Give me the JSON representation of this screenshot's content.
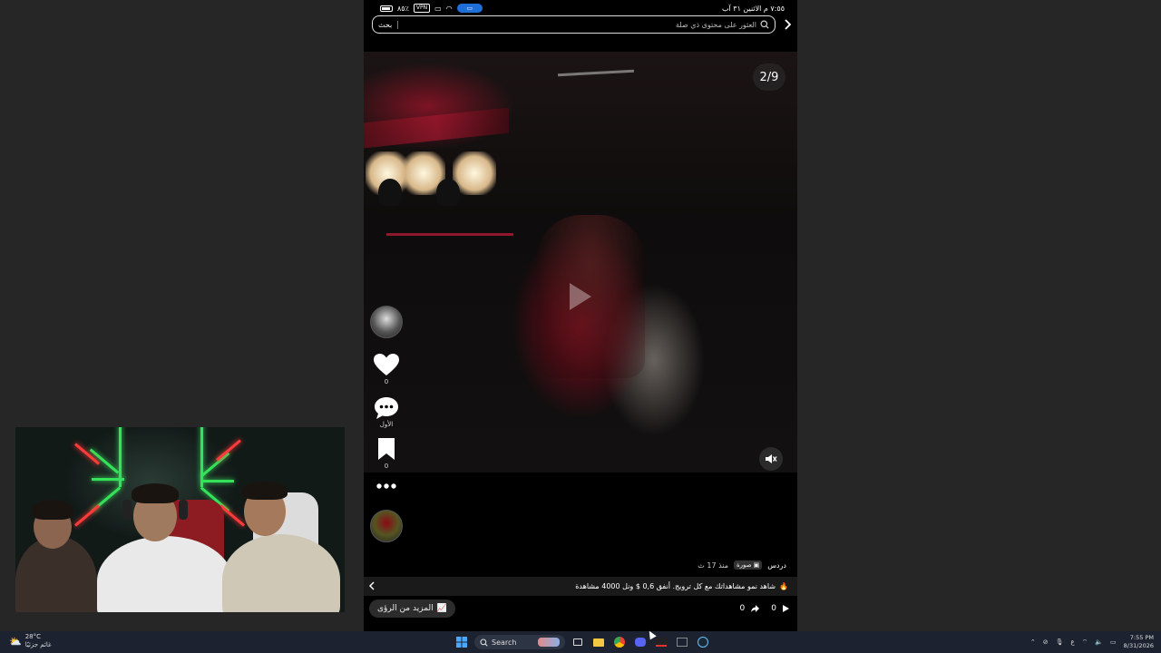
{
  "status_bar": {
    "time_date": "٧:٥٥ م  الاثنين ٣١ آب",
    "battery": "٨٥٪",
    "vpn": "VPN"
  },
  "search": {
    "placeholder": "العثور على محتوى ذي صلة",
    "button_label": "بحث"
  },
  "video": {
    "counter": "2/9"
  },
  "actions": {
    "like_count": "0",
    "comment_label": "الأول",
    "save_count": "0"
  },
  "post_meta": {
    "category": "دردس",
    "badge": "صورة",
    "time": "منذ 17 ث"
  },
  "promo": {
    "text": "شاهد نمو مشاهداتك مع كل ترويج. أنفق 0,6 $ ونل 4000 مشاهدة"
  },
  "bottom_bar": {
    "more_insights": "المزيد من الرؤى",
    "shares": "0",
    "plays": "0"
  },
  "taskbar": {
    "weather_temp": "28°C",
    "weather_desc": "غائم جزئيًا",
    "search_label": "Search",
    "lang": "ع",
    "time": "7:55 PM",
    "date": "8/31/2026"
  },
  "colors": {
    "accent_blue": "#1e6fd8",
    "neon_green": "#35e35a",
    "neon_red": "#ff3a3a"
  }
}
